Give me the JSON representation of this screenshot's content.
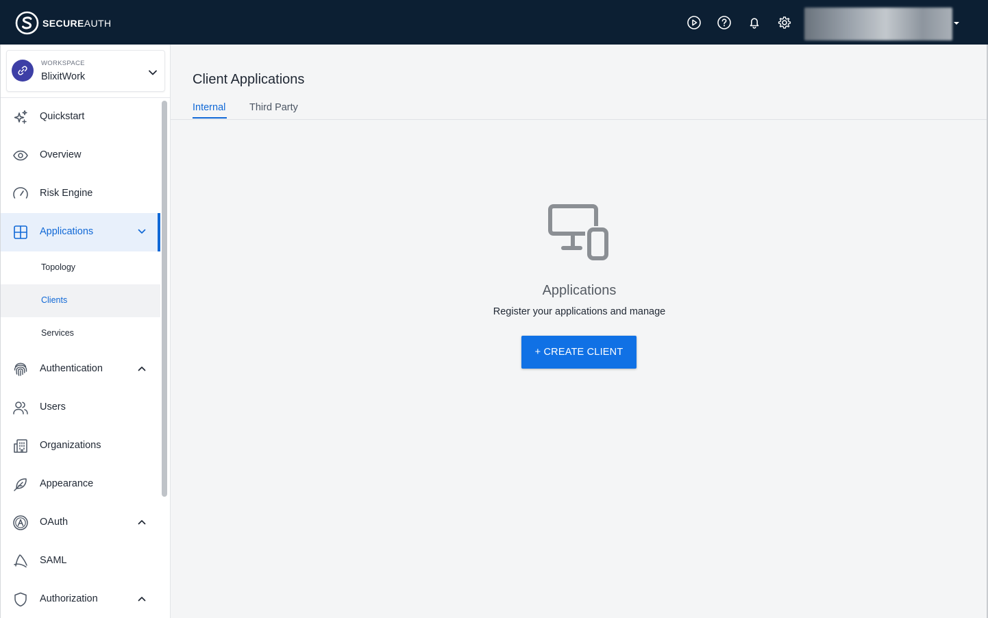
{
  "brand": {
    "bold": "SECURE",
    "light": "AUTH"
  },
  "header": {
    "icons": [
      "play-circle-icon",
      "help-circle-icon",
      "bell-icon",
      "gear-icon"
    ]
  },
  "workspace": {
    "label": "WORKSPACE",
    "name": "BlixitWork"
  },
  "sidebar": {
    "items": [
      {
        "label": "Quickstart",
        "icon": "sparkles-icon"
      },
      {
        "label": "Overview",
        "icon": "eye-icon"
      },
      {
        "label": "Risk Engine",
        "icon": "gauge-icon"
      },
      {
        "label": "Applications",
        "icon": "grid-icon",
        "active": true,
        "expanded": true,
        "children": [
          {
            "label": "Topology"
          },
          {
            "label": "Clients",
            "selected": true
          },
          {
            "label": "Services"
          }
        ]
      },
      {
        "label": "Authentication",
        "icon": "fingerprint-icon"
      },
      {
        "label": "Users",
        "icon": "users-icon"
      },
      {
        "label": "Organizations",
        "icon": "building-icon"
      },
      {
        "label": "Appearance",
        "icon": "feather-icon"
      },
      {
        "label": "OAuth",
        "icon": "oauth-icon"
      },
      {
        "label": "SAML",
        "icon": "saml-icon"
      },
      {
        "label": "Authorization",
        "icon": "shield-icon"
      }
    ]
  },
  "main": {
    "title": "Client Applications",
    "tabs": [
      {
        "label": "Internal",
        "active": true
      },
      {
        "label": "Third Party",
        "active": false
      }
    ],
    "empty_state": {
      "icon": "devices-icon",
      "title": "Applications",
      "subtitle": "Register your applications and manage",
      "button_label": "+ CREATE CLIENT"
    }
  },
  "colors": {
    "topbar": "#0c1f33",
    "accent": "#1068d6",
    "button": "#1071e5",
    "workspace_avatar": "#3d3fa6"
  }
}
